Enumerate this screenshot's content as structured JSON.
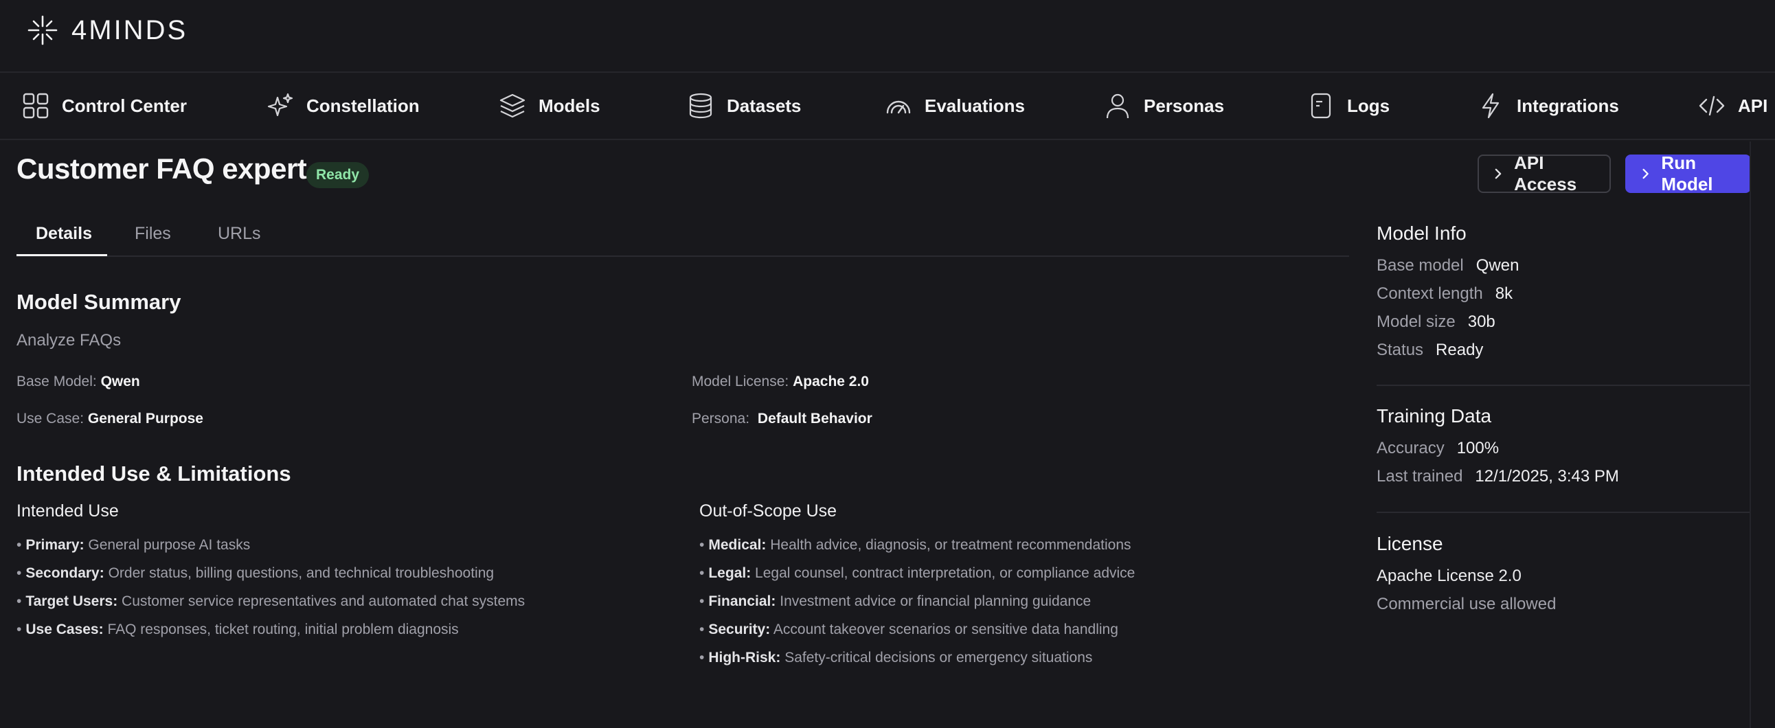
{
  "brand": {
    "name": "4MINDS"
  },
  "nav": {
    "items": [
      {
        "label": "Control Center",
        "icon": "grid-icon"
      },
      {
        "label": "Constellation",
        "icon": "sparkles-icon"
      },
      {
        "label": "Models",
        "icon": "layers-icon"
      },
      {
        "label": "Datasets",
        "icon": "database-icon"
      },
      {
        "label": "Evaluations",
        "icon": "gauge-icon"
      },
      {
        "label": "Personas",
        "icon": "user-icon"
      },
      {
        "label": "Logs",
        "icon": "document-icon"
      },
      {
        "label": "Integrations",
        "icon": "lightning-icon"
      },
      {
        "label": "API",
        "icon": "code-icon"
      }
    ]
  },
  "header": {
    "title": "Customer FAQ expert",
    "status": "Ready",
    "api_access_label": "API Access",
    "run_model_label": "Run Model"
  },
  "tabs": [
    {
      "label": "Details",
      "active": true
    },
    {
      "label": "Files",
      "active": false
    },
    {
      "label": "URLs",
      "active": false
    }
  ],
  "summary": {
    "heading": "Model Summary",
    "description": "Analyze FAQs",
    "base_model": {
      "label": "Base Model:",
      "value": "Qwen"
    },
    "license": {
      "label": "Model License:",
      "value": "Apache 2.0"
    },
    "use_case": {
      "label": "Use Case:",
      "value": "General Purpose"
    },
    "persona": {
      "label": "Persona:",
      "value": "Default Behavior"
    }
  },
  "intended": {
    "heading": "Intended Use & Limitations",
    "intended_use": {
      "title": "Intended Use",
      "items": [
        {
          "key": "Primary:",
          "text": "General purpose AI tasks"
        },
        {
          "key": "Secondary:",
          "text": "Order status, billing questions, and technical troubleshooting"
        },
        {
          "key": "Target Users:",
          "text": "Customer service representatives and automated chat systems"
        },
        {
          "key": "Use Cases:",
          "text": "FAQ responses, ticket routing, initial problem diagnosis"
        }
      ]
    },
    "out_of_scope": {
      "title": "Out-of-Scope Use",
      "items": [
        {
          "key": "Medical:",
          "text": "Health advice, diagnosis, or treatment recommendations"
        },
        {
          "key": "Legal:",
          "text": "Legal counsel, contract interpretation, or compliance advice"
        },
        {
          "key": "Financial:",
          "text": "Investment advice or financial planning guidance"
        },
        {
          "key": "Security:",
          "text": "Account takeover scenarios or sensitive data handling"
        },
        {
          "key": "High-Risk:",
          "text": "Safety-critical decisions or emergency situations"
        }
      ]
    }
  },
  "model_info": {
    "title": "Model Info",
    "rows": [
      {
        "label": "Base model",
        "value": "Qwen"
      },
      {
        "label": "Context length",
        "value": "8k"
      },
      {
        "label": "Model size",
        "value": "30b"
      },
      {
        "label": "Status",
        "value": "Ready"
      }
    ]
  },
  "training_data": {
    "title": "Training Data",
    "rows": [
      {
        "label": "Accuracy",
        "value": "100%"
      },
      {
        "label": "Last trained",
        "value": "12/1/2025, 3:43 PM"
      }
    ]
  },
  "license": {
    "title": "License",
    "name": "Apache License 2.0",
    "note": "Commercial use allowed"
  },
  "colors": {
    "background": "#18181c",
    "accent": "#4f46e5",
    "ready_badge_bg": "#1f3526",
    "ready_badge_text": "#8fe5a8"
  }
}
